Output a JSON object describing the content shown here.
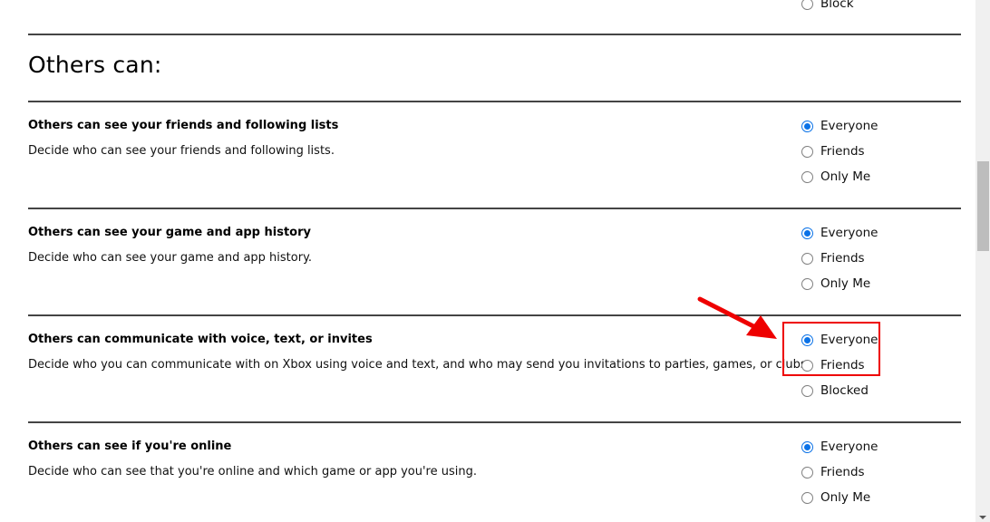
{
  "prev_section": {
    "last_option_label": "Block"
  },
  "section": {
    "title": "Others can:"
  },
  "settings": [
    {
      "title": "Others can see your friends and following lists",
      "description": "Decide who can see your friends and following lists.",
      "options": [
        {
          "label": "Everyone",
          "checked": true
        },
        {
          "label": "Friends",
          "checked": false
        },
        {
          "label": "Only Me",
          "checked": false
        }
      ]
    },
    {
      "title": "Others can see your game and app history",
      "description": "Decide who can see your game and app history.",
      "options": [
        {
          "label": "Everyone",
          "checked": true
        },
        {
          "label": "Friends",
          "checked": false
        },
        {
          "label": "Only Me",
          "checked": false
        }
      ]
    },
    {
      "title": "Others can communicate with voice, text, or invites",
      "description": "Decide who you can communicate with on Xbox using voice and text, and who may send you invitations to parties, games, or clubs.",
      "options": [
        {
          "label": "Everyone",
          "checked": true
        },
        {
          "label": "Friends",
          "checked": false
        },
        {
          "label": "Blocked",
          "checked": false
        }
      ]
    },
    {
      "title": "Others can see if you're online",
      "description": "Decide who can see that you're online and which game or app you're using.",
      "options": [
        {
          "label": "Everyone",
          "checked": true
        },
        {
          "label": "Friends",
          "checked": false
        },
        {
          "label": "Only Me",
          "checked": false
        }
      ]
    }
  ],
  "annotation": {
    "color": "#ee0000",
    "target": "communicate-options Everyone/Friends"
  },
  "colors": {
    "radio_accent": "#0b72e7",
    "divider": "#444444"
  }
}
